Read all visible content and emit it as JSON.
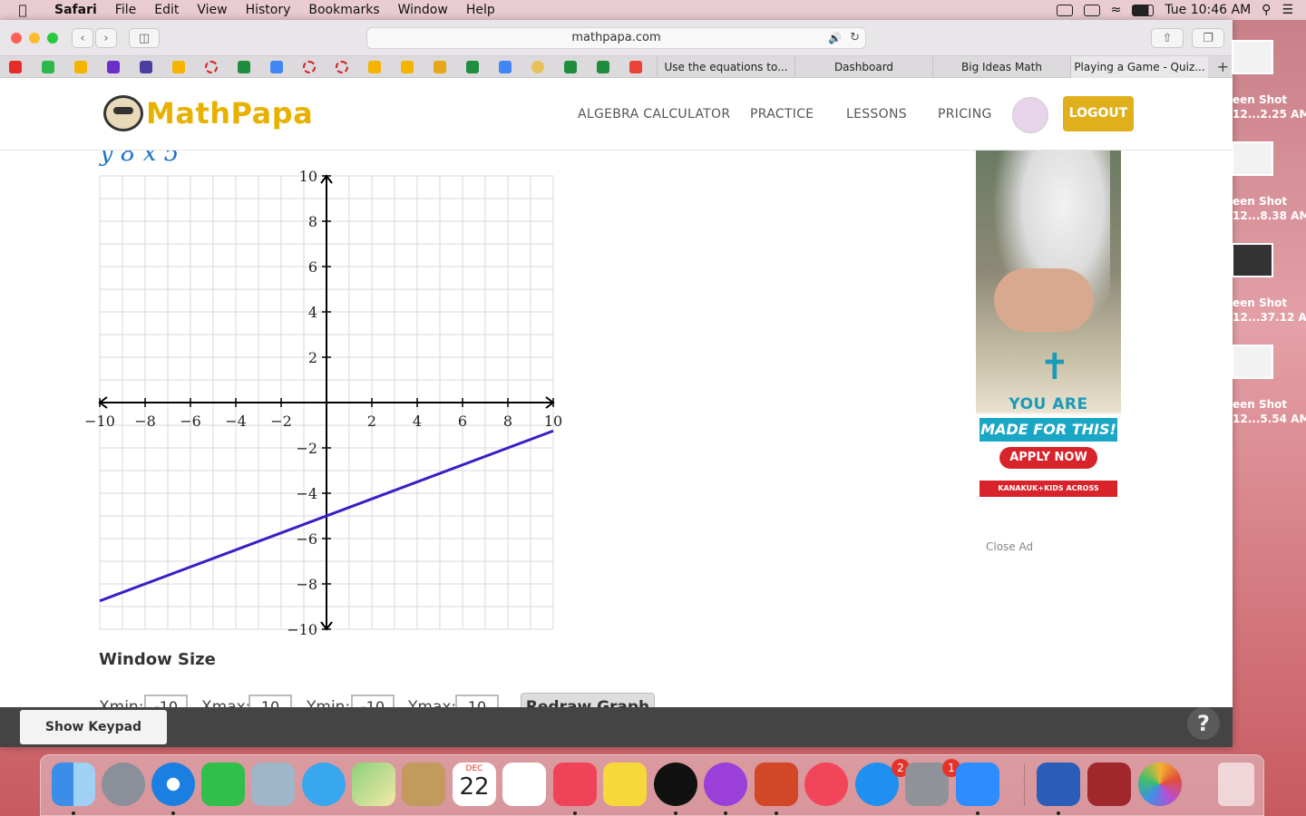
{
  "menubar": {
    "app": "Safari",
    "items": [
      "File",
      "Edit",
      "View",
      "History",
      "Bookmarks",
      "Window",
      "Help"
    ],
    "clock": "Tue 10:46 AM"
  },
  "browser": {
    "url": "mathpapa.com",
    "tabs": [
      "Use the equations to...",
      "Dashboard",
      "Big Ideas Math",
      "Playing a Game - Quiz..."
    ]
  },
  "site": {
    "logo": "MathPapa",
    "nav": [
      "ALGEBRA CALCULATOR",
      "PRACTICE",
      "LESSONS",
      "PRICING"
    ],
    "logout": "LOGOUT"
  },
  "graph": {
    "eq_fragment": "y  8 x  5",
    "xticks": [
      "−10",
      "−8",
      "−6",
      "−4",
      "−2",
      "2",
      "4",
      "6",
      "8",
      "10"
    ],
    "yticks": [
      "10",
      "8",
      "6",
      "4",
      "2",
      "−2",
      "−4",
      "−6",
      "−8",
      "−10"
    ],
    "xlim": [
      -10,
      10
    ],
    "ylim": [
      -10,
      10
    ],
    "line": {
      "x": [
        -10,
        10
      ],
      "y": [
        -8.75,
        -1.25
      ],
      "color": "#3a1fc4"
    }
  },
  "window_size": {
    "title": "Window Size",
    "xmin_label": "Xmin:",
    "xmin": "-10",
    "xmax_label": "Xmax:",
    "xmax": "10",
    "ymin_label": "Ymin:",
    "ymin": "-10",
    "ymax_label": "Ymax:",
    "ymax": "10",
    "redraw": "Redraw Graph"
  },
  "ad": {
    "line1": "YOU ARE",
    "line2": "MADE FOR THIS!",
    "cta": "APPLY NOW",
    "footer": "KANAKUK+KIDS ACROSS AMERICA",
    "close": "Close Ad"
  },
  "keypad": {
    "show": "Show Keypad",
    "help": "?"
  },
  "desktop": {
    "shots": [
      "een Shot\n12...2.25 AM",
      "een Shot\n12...8.38 AM",
      "een Shot\n12...37.12 AM",
      "een Shot\n12...5.54 AM"
    ]
  },
  "dock": {
    "calendar_month": "DEC",
    "calendar_day": "22",
    "appstore_badge": "2",
    "prefs_badge": "1"
  }
}
